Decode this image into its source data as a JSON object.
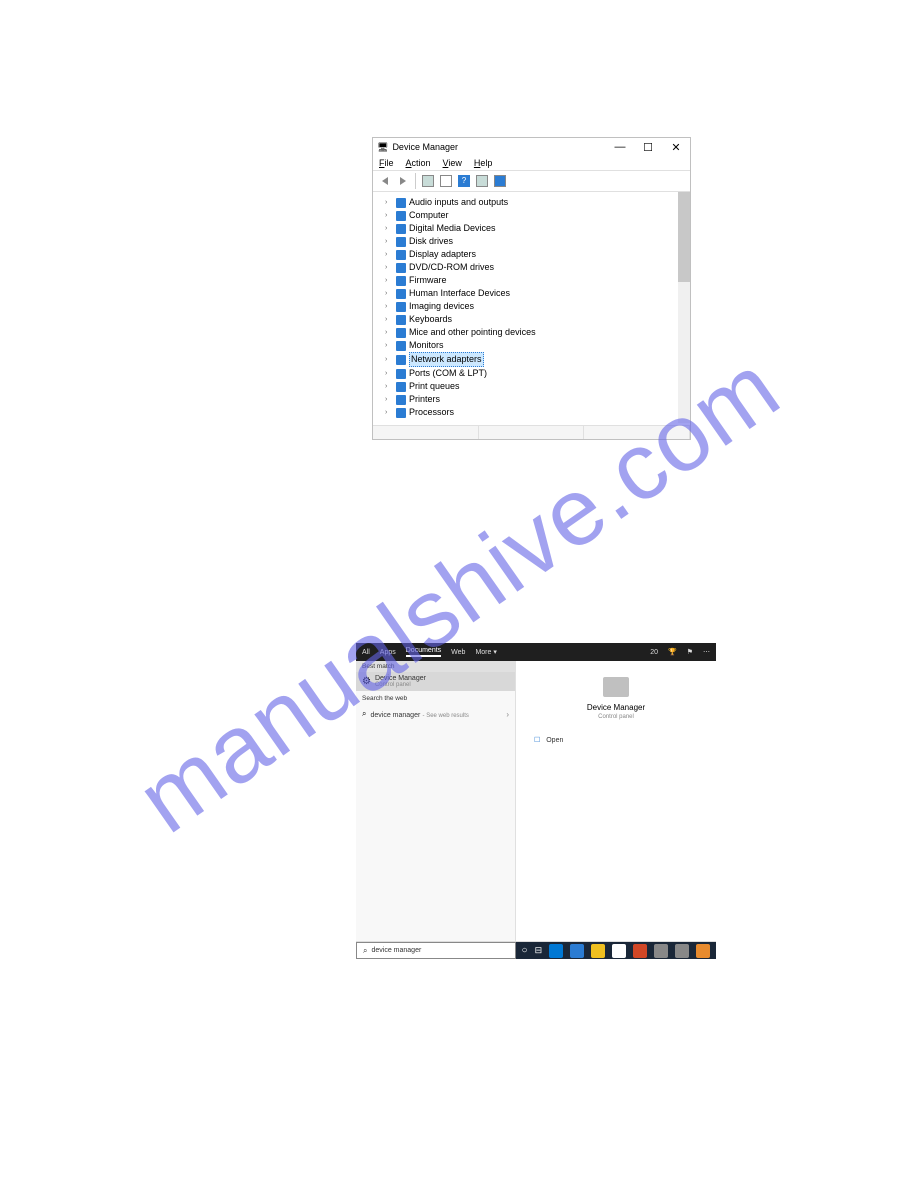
{
  "watermark": "manualshive.com",
  "device_manager": {
    "title": "Device Manager",
    "menus": {
      "file": "File",
      "action": "Action",
      "view": "View",
      "help": "Help"
    },
    "controls": {
      "min": "—",
      "max": "☐",
      "close": "✕"
    },
    "tree": [
      {
        "label": "Audio inputs and outputs",
        "selected": false
      },
      {
        "label": "Computer",
        "selected": false
      },
      {
        "label": "Digital Media Devices",
        "selected": false
      },
      {
        "label": "Disk drives",
        "selected": false
      },
      {
        "label": "Display adapters",
        "selected": false
      },
      {
        "label": "DVD/CD-ROM drives",
        "selected": false
      },
      {
        "label": "Firmware",
        "selected": false
      },
      {
        "label": "Human Interface Devices",
        "selected": false
      },
      {
        "label": "Imaging devices",
        "selected": false
      },
      {
        "label": "Keyboards",
        "selected": false
      },
      {
        "label": "Mice and other pointing devices",
        "selected": false
      },
      {
        "label": "Monitors",
        "selected": false
      },
      {
        "label": "Network adapters",
        "selected": true
      },
      {
        "label": "Ports (COM & LPT)",
        "selected": false
      },
      {
        "label": "Print queues",
        "selected": false
      },
      {
        "label": "Printers",
        "selected": false
      },
      {
        "label": "Processors",
        "selected": false
      }
    ]
  },
  "search_panel": {
    "tabs": {
      "all": "All",
      "apps": "Apps",
      "documents": "Documents",
      "web": "Web",
      "more": "More ▾",
      "count": "20"
    },
    "best_match_label": "Best match",
    "best_match": {
      "title": "Device Manager",
      "sub": "Control panel"
    },
    "search_web_label": "Search the web",
    "web_result": {
      "text": "device manager",
      "suffix": " - See web results"
    },
    "preview": {
      "title": "Device Manager",
      "sub": "Control panel",
      "open": "Open"
    },
    "search_value": "device manager"
  },
  "icon_colors": [
    "#0078d4",
    "#2b2b2b",
    "#0078d4",
    "#2b7cd3",
    "#f0c020",
    "#ffffff",
    "#d24726",
    "#888888",
    "#888888",
    "#e88b2e"
  ]
}
